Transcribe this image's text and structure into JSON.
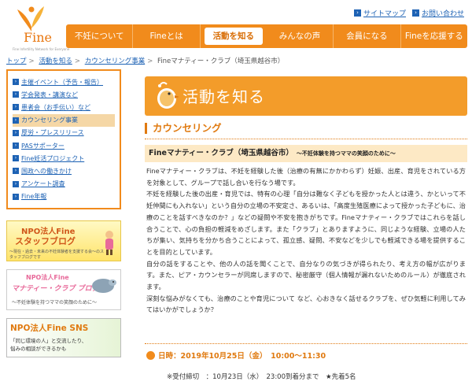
{
  "header": {
    "logo_text": "Fine",
    "logo_sub": "Fine Infertility Network for Everyone",
    "links": [
      "サイトマップ",
      "お問い合わせ"
    ]
  },
  "nav": [
    "不妊について",
    "Fineとは",
    "活動を知る",
    "みんなの声",
    "会員になる",
    "Fineを応援する"
  ],
  "breadcrumb": [
    "トップ",
    "活動を知る",
    "カウンセリング事業",
    "Fineマナティー・クラブ（埼玉県越谷市）"
  ],
  "sidebar": {
    "items": [
      "主催イベント（予告・報告）",
      "学会発表・講演など",
      "患者会（お手伝い）など",
      "カウンセリング事業",
      "厚労・プレスリリース",
      "PASサポーター",
      "Fine妊活プロジェクト",
      "国政への働きかけ",
      "アンケート調査",
      "Fine年報"
    ],
    "current": 3
  },
  "banners": {
    "b1_title": "NPO法人Fine",
    "b1_title2": "スタッフブログ",
    "b1_sub": "〜現在・過去・未来の不妊体験者を支援する会〜のスタッフブログです",
    "b2_title": "NPO法人Fine",
    "b2_title2": "マナティー・クラブ ブログ",
    "b2_sub": "〜不妊体験を持つママの笑顔のために〜",
    "b3_title": "NPO法人Fine SNS",
    "b3_sub1": "「同じ環境の人」と交流したり、",
    "b3_sub2": "悩みの相談ができるかも"
  },
  "hero_title": "活動を知る",
  "section_title": "カウンセリング",
  "subhead": {
    "title": "Fineマナティー・クラブ（埼玉県越谷市）",
    "tag": "〜不妊体験を持つママの笑顔のために〜"
  },
  "body": [
    "Fineマナティー・クラブは、不妊を経験した後（治療の有無にかかわらず）妊娠、出産、育児をされている方を対象として、グループで話し合いを行なう場です。",
    "不妊を経験した後の出産・育児では、特有の心理「自分は難なく子どもを授かった人とは違う、かといって不妊仲間にも入れない」という自分の立場の不安定さ、あるいは、「高度生殖医療によって授かった子どもに、治療のことを話すべきなのか？」などの疑問や不安を抱きがちです。Fineマナティー・クラブではこれらを話し合うことで、心の負担の軽減をめざします。また「クラブ」とありますように、同じような経験、立場の人たちが集い、気持ちを分かち合うことによって、孤立感、疑問、不安などを少しでも軽減できる場を提供することを目的としています。",
    "自分の話をすることや、他の人の話を聞くことで、自分なりの気づきが得られたり、考え方の幅が広がります。また、ピア・カウンセラーが同席しますので、秘密厳守（個人情報が漏れないためのルール）が徹底されます。",
    "深刻な悩みがなくても、治療のことや育児について など、心おきなく話せるクラブを、ぜひ気軽に利用してみてはいかがでしょうか？"
  ],
  "date": "日時：2019年10月25日（金）　10:00〜11:30",
  "deadline": "※受付締切　：10月23日（水）　23:00到着分まで　★先着5名",
  "colors": {
    "accent": "#f18b1c",
    "link": "#1d62b4"
  }
}
